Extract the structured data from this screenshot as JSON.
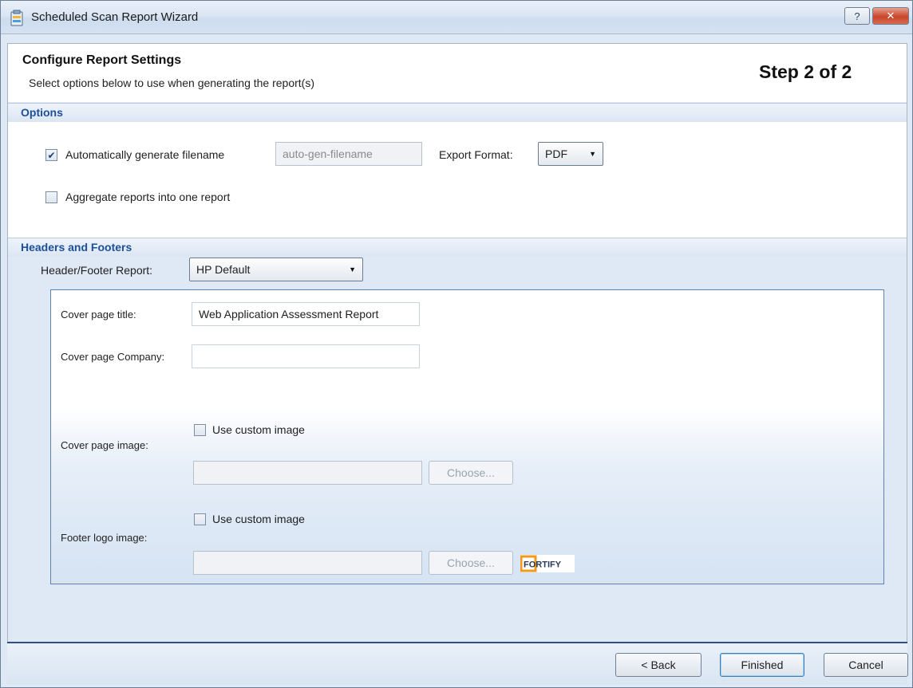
{
  "window": {
    "title": "Scheduled Scan Report Wizard",
    "help_label": "?",
    "close_label": "✕"
  },
  "header": {
    "title": "Configure Report Settings",
    "subtitle": "Select options below to use when generating the report(s)",
    "step": "Step 2 of 2"
  },
  "options": {
    "section_title": "Options",
    "auto_filename": {
      "label": "Automatically generate filename",
      "checked": true,
      "check_glyph": "✔"
    },
    "filename_value": "auto-gen-filename",
    "export_format_label": "Export Format:",
    "export_format_value": "PDF",
    "aggregate": {
      "label": "Aggregate reports into one report",
      "checked": false
    }
  },
  "headers_footers": {
    "section_title": "Headers and Footers",
    "report_label": "Header/Footer Report:",
    "report_value": "HP Default",
    "cover_title_label": "Cover page title:",
    "cover_title_value": "Web Application Assessment Report",
    "cover_company_label": "Cover page Company:",
    "cover_company_value": "",
    "cover_image_label": "Cover page image:",
    "cover_custom_label": "Use custom image",
    "cover_choose_label": "Choose...",
    "footer_logo_label": "Footer logo image:",
    "footer_custom_label": "Use custom image",
    "footer_choose_label": "Choose...",
    "footer_logo_text": "FORTIFY"
  },
  "buttons": {
    "back": "< Back",
    "finished": "Finished",
    "cancel": "Cancel"
  },
  "colors": {
    "section_title": "#1d4f9a",
    "footer_border": "#2f4f86",
    "logo_orange": "#f39a1b"
  }
}
